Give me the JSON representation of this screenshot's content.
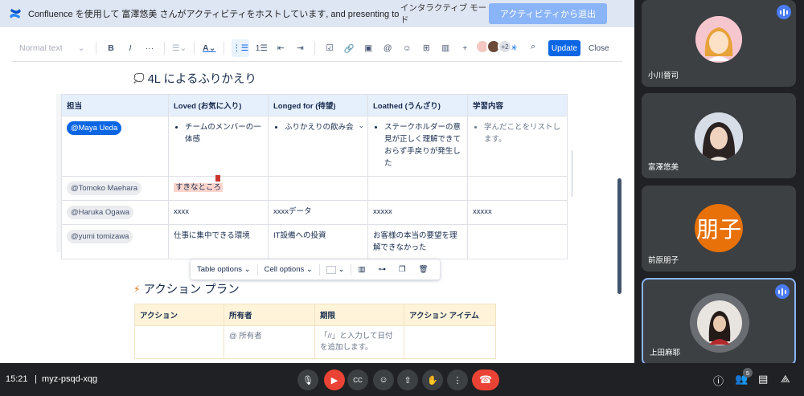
{
  "banner": {
    "text": "Confluence を使用して 富澤悠美 さんがアクティビティをホストしています, and presenting to everyone",
    "mode": "インタラクティブ モード",
    "exit_label": "アクティビティから退出"
  },
  "toolbar": {
    "text_style": "Normal text",
    "more": "···",
    "plus_label": "+",
    "avatar_more": "+2",
    "update_label": "Update",
    "close_label": "Close"
  },
  "section1": {
    "emoji": "💭",
    "title": "4L によるふりかえり"
  },
  "table1": {
    "headers": [
      "担当",
      "Loved (お気に入り)",
      "Longed for (待望)",
      "Loathed (うんざり)",
      "学習内容"
    ],
    "rows": [
      {
        "owner": "@Maya Ueda",
        "loved": "チームのメンバーの一体感",
        "longed": "ふりかえりの飲み会",
        "loathed": "ステークホルダーの意見が正しく理解できておらず手戻りが発生した",
        "learned": "学んだことをリストします。"
      },
      {
        "owner": "@Tomoko Maehara",
        "loved": "すきなところ",
        "longed": "",
        "loathed": "",
        "learned": ""
      },
      {
        "owner": "@Haruka Ogawa",
        "loved": "xxxx",
        "longed": "xxxxデータ",
        "loathed": "xxxxx",
        "learned": "xxxxx"
      },
      {
        "owner": "@yumi tomizawa",
        "loved": "仕事に集中できる環境",
        "longed": "IT設備への投資",
        "loathed": "お客様の本当の要望を理解できなかった",
        "learned": ""
      }
    ]
  },
  "float_toolbar": {
    "table_options": "Table options",
    "cell_options": "Cell options"
  },
  "section2": {
    "emoji": "⚡",
    "title": "アクション プラン"
  },
  "table2": {
    "headers": [
      "アクション",
      "所有者",
      "期限",
      "アクション アイテム"
    ],
    "row": {
      "action": "",
      "owner": "@ 所有者",
      "due": "「//」と入力して日付を追加します。",
      "item": ""
    }
  },
  "participants": [
    {
      "name": "小川晉司"
    },
    {
      "name": "富澤悠美"
    },
    {
      "name": "前原朋子",
      "initial": "朋子"
    },
    {
      "name": "上田麻耶"
    }
  ],
  "bottom": {
    "time": "15:21",
    "meeting_code": "myz-psqd-xqg",
    "participant_count": "5"
  },
  "colors": {
    "accent": "#0c66e4",
    "end_call": "#ea4335",
    "initial_bg": "#e8710a"
  }
}
